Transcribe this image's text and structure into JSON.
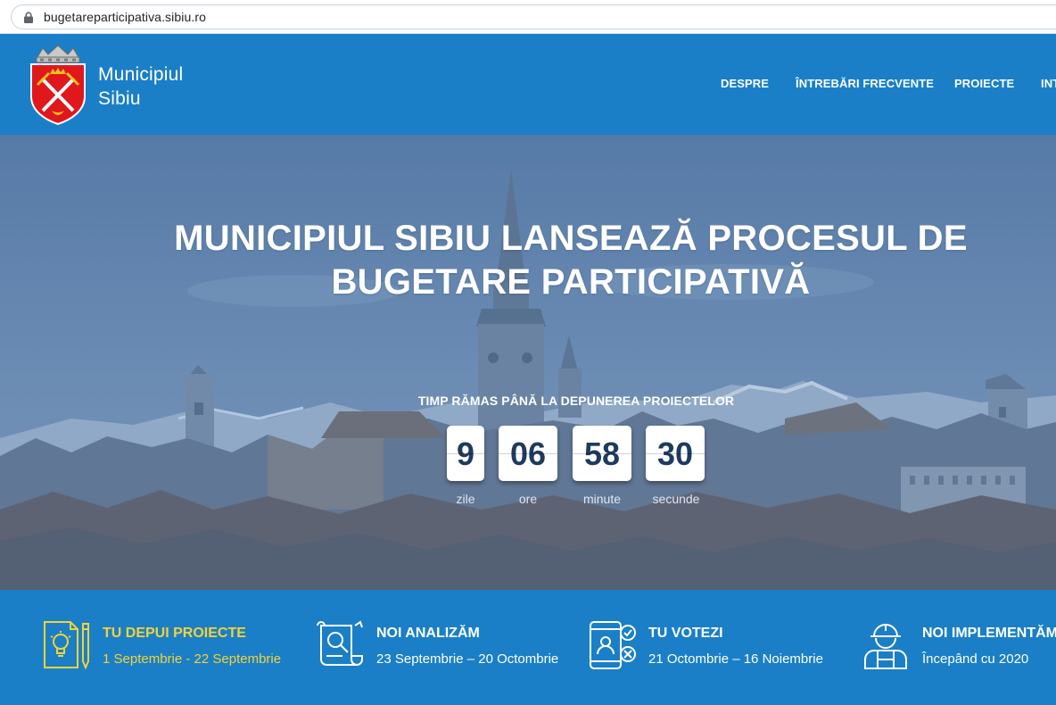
{
  "browser": {
    "url": "bugetareparticipativa.sibiu.ro"
  },
  "header": {
    "brand_line1": "Municipiul",
    "brand_line2": "Sibiu",
    "nav": [
      "DESPRE",
      "ÎNTREBĂRI FRECVENTE",
      "PROIECTE",
      "INT"
    ]
  },
  "hero": {
    "title_line1": "MUNICIPIUL SIBIU LANSEAZĂ PROCESUL DE",
    "title_line2": "BUGETARE PARTICIPATIVĂ",
    "countdown_label": "TIMP RĂMAS PÂNĂ LA DEPUNEREA PROIECTELOR",
    "countdown": [
      {
        "value": "9",
        "unit": "zile"
      },
      {
        "value": "06",
        "unit": "ore"
      },
      {
        "value": "58",
        "unit": "minute"
      },
      {
        "value": "30",
        "unit": "secunde"
      }
    ]
  },
  "steps": [
    {
      "title": "TU DEPUI PROIECTE",
      "dates": "1 Septembrie - 22 Septembrie",
      "icon": "document-lightbulb-icon"
    },
    {
      "title": "NOI ANALIZĂM",
      "dates": "23 Septembrie – 20 Octombrie",
      "icon": "scroll-magnifier-icon"
    },
    {
      "title": "TU VOTEZI",
      "dates": "21 Octombrie – 16 Noiembrie",
      "icon": "phone-vote-icon"
    },
    {
      "title": "NOI IMPLEMENTĂM",
      "dates": "Începând cu 2020",
      "icon": "construction-worker-icon"
    }
  ],
  "colors": {
    "header_bg": "#1a7fc6",
    "highlight": "#f3d23a",
    "countdown_text": "#1e3a5f"
  }
}
